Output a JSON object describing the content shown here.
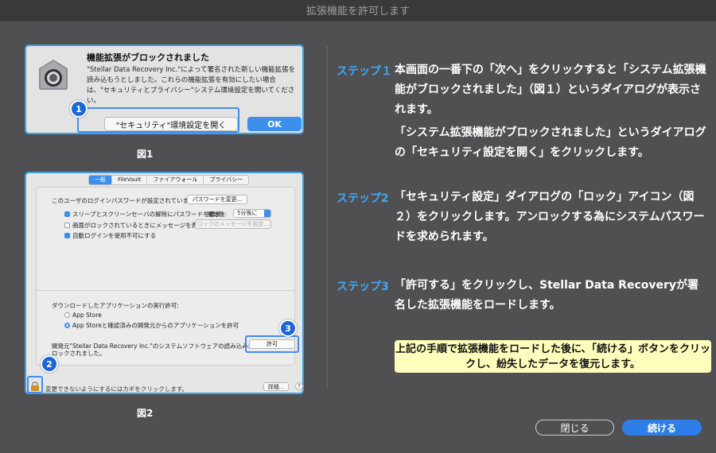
{
  "window": {
    "title": "拡張機能を許可します"
  },
  "figure1": {
    "caption": "図1",
    "title": "機能拡張がブロックされました",
    "message": "\"Stellar Data Recovery Inc.\"によって署名された新しい機能拡張を読み込もうとしました。これらの機能拡張を有効にしたい場合は、\"セキュリティとプライバシー\"システム環境設定を開いてください。",
    "open_button": "\"セキュリティ\"環境設定を開く",
    "ok_button": "OK",
    "marker": "1"
  },
  "figure2": {
    "caption": "図2",
    "tabs": [
      "一般",
      "FileVault",
      "ファイアウォール",
      "プライバシー"
    ],
    "password_text": "このユーザのログインパスワードが設定されています",
    "change_password_button": "パスワードを変更...",
    "sleep_check": "スリープとスクリーンセーバの解除にパスワードを要求",
    "start_label": "開始後:",
    "start_value": "5分後に",
    "locked_msg_check": "画面がロックされているときにメッセージを表示",
    "set_lock_msg_button": "ロックのメッセージを設定...",
    "auto_login_check": "自動ログインを使用不可にする",
    "download_label": "ダウンロードしたアプリケーションの実行許可:",
    "radio_app_store": "App Store",
    "radio_app_store_dev": "App Storeと確認済みの開発元からのアプリケーションを許可",
    "blocked_text_1": "開発元\"Stellar Data Recovery Inc.\"のシステムソフトウェアの読み込みがブ",
    "blocked_text_2": "ロックされました。",
    "allow_button": "許可",
    "lock_text": "変更できないようにするにはカギをクリックします。",
    "advanced_button": "詳細...",
    "help_button": "?",
    "marker2": "2",
    "marker3": "3"
  },
  "steps": [
    {
      "label": "ステップ１",
      "text": "本画面の一番下の「次へ」をクリックすると「システム拡張機能がブロックされました」（図１）というダイアログが表示されます。"
    },
    {
      "label": "",
      "text": "「システム拡張機能がブロックされました」というダイアログの「セキュリティ設定を開く」をクリックします。"
    },
    {
      "label": "ステップ2",
      "text": "「セキュリティ設定」ダイアログの「ロック」アイコン（図２）をクリックします。アンロックする為にシステムパスワードを求められます。"
    },
    {
      "label": "ステップ3",
      "text": "「許可する」をクリックし、Stellar Data Recoveryが署名した拡張機能をロードします。"
    }
  ],
  "note": "上記の手順で拡張機能をロードした後に、「続ける」ボタンをクリックし、紛失したデータを復元します。",
  "buttons": {
    "close": "閉じる",
    "continue": "続ける"
  },
  "colors": {
    "accent": "#3d8fec",
    "step_label": "#3fa9f5",
    "note_bg": "#ffffbd",
    "background": "#505053"
  }
}
